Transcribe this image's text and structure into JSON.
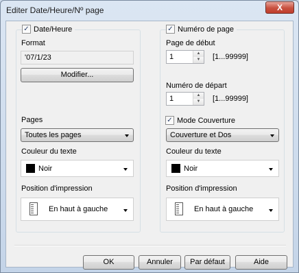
{
  "window": {
    "title": "Editer Date/Heure/Nº page",
    "close_label": "X"
  },
  "left": {
    "enable_label": "Date/Heure",
    "enabled_mark": "✓",
    "format_label": "Format",
    "format_value": "'07/1/23",
    "modify_label": "Modifier...",
    "pages_label": "Pages",
    "pages_value": "Toutes les pages",
    "color_label": "Couleur du texte",
    "color_value": "Noir",
    "position_label": "Position d'impression",
    "position_value": "En haut à gauche"
  },
  "right": {
    "enable_label": "Numéro de page",
    "enabled_mark": "✓",
    "start_page_label": "Page de début",
    "start_page_value": "1",
    "start_page_range": "[1...99999]",
    "start_number_label": "Numéro de départ",
    "start_number_value": "1",
    "start_number_range": "[1...99999]",
    "cover_mode_label": "Mode Couverture",
    "cover_mode_mark": "✓",
    "cover_value": "Couverture et Dos",
    "color_label": "Couleur du texte",
    "color_value": "Noir",
    "position_label": "Position d'impression",
    "position_value": "En haut à gauche"
  },
  "footer": {
    "ok_label": "OK",
    "cancel_label": "Annuler",
    "default_label": "Par défaut",
    "help_label": "Aide"
  },
  "colors": {
    "text_color_swatch": "#000000",
    "close_button": "#c8503f"
  }
}
